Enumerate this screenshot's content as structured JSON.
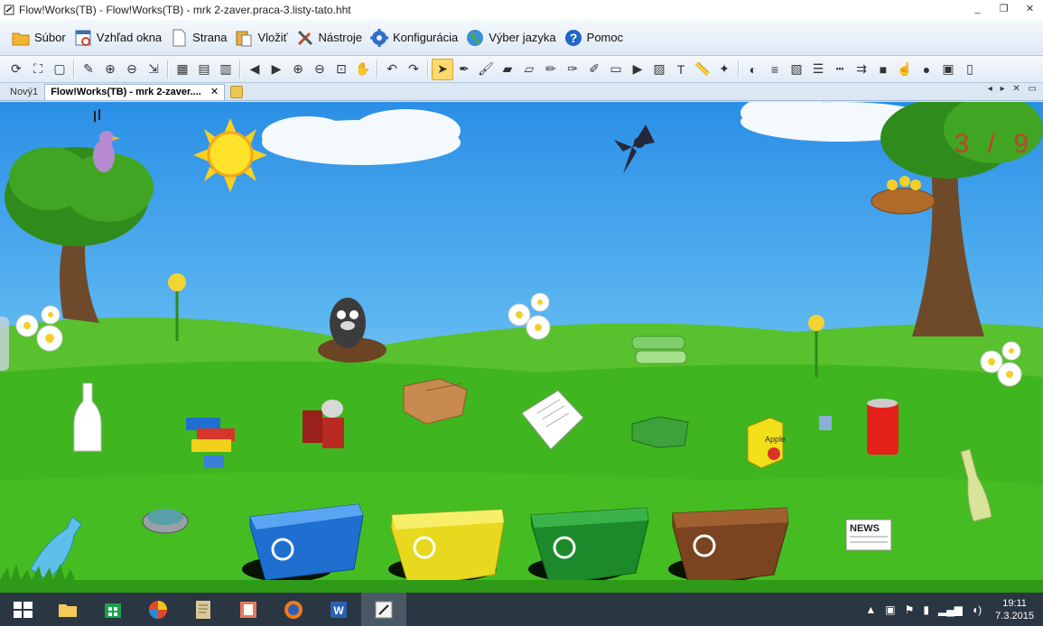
{
  "window": {
    "title": "Flow!Works(TB) - Flow!Works(TB) - mrk 2-zaver.praca-3.listy-tato.hht",
    "controls": [
      "_",
      "❐",
      "✕"
    ]
  },
  "menu": [
    {
      "label": "Súbor",
      "icon": "folder-icon"
    },
    {
      "label": "Vzhľad okna",
      "icon": "refresh-window-icon"
    },
    {
      "label": "Strana",
      "icon": "page-icon"
    },
    {
      "label": "Vložiť",
      "icon": "paste-icon"
    },
    {
      "label": "Nástroje",
      "icon": "tools-icon"
    },
    {
      "label": "Konfigurácia",
      "icon": "gear-icon"
    },
    {
      "label": "Výber jazyka",
      "icon": "globe-icon"
    },
    {
      "label": "Pomoc",
      "icon": "help-icon"
    }
  ],
  "toolbar": {
    "items": [
      "refresh",
      "fullscreen",
      "window",
      "|",
      "edit",
      "new-page",
      "delete-page",
      "import-page",
      "|",
      "image-page",
      "save-page",
      "page-settings",
      "|",
      "prev-page",
      "next-page",
      "zoom-in",
      "zoom-out",
      "zoom-fit",
      "pan-hand",
      "|",
      "undo",
      "redo",
      "|",
      "select-arrow",
      "pen",
      "brush",
      "marker",
      "highlighter",
      "pencil",
      "fountain-pen",
      "creative-pen",
      "eraser",
      "video",
      "image",
      "text",
      "ruler",
      "magic-wand",
      "|",
      "palette",
      "line-style",
      "hatch",
      "list",
      "dashes",
      "arrows",
      "camera",
      "hand-pointer",
      "colors",
      "screen",
      "phone"
    ],
    "active": "select-arrow"
  },
  "tabs": [
    {
      "label": "Nový1",
      "active": false
    },
    {
      "label": "Flow!Works(TB) - mrk 2-zaver....",
      "active": true
    }
  ],
  "tab_close": "✕",
  "tab_nav": "◂ ▸ ✕ ▭",
  "canvas": {
    "page_counter": "3 / 9",
    "items": [
      {
        "name": "sun"
      },
      {
        "name": "cloud"
      },
      {
        "name": "bird-swallow"
      },
      {
        "name": "bird-singing"
      },
      {
        "name": "mole"
      },
      {
        "name": "glass-bottle"
      },
      {
        "name": "lego-bricks"
      },
      {
        "name": "tin-cans"
      },
      {
        "name": "cardboard-box"
      },
      {
        "name": "paper-sheets"
      },
      {
        "name": "broken-bottle"
      },
      {
        "name": "plastic-bottles"
      },
      {
        "name": "juice-box",
        "label": "Apple"
      },
      {
        "name": "soda-can"
      },
      {
        "name": "wine-bottle"
      },
      {
        "name": "plastic-bottle-blue"
      },
      {
        "name": "tuna-can"
      },
      {
        "name": "newspaper",
        "label": "NEWS"
      },
      {
        "name": "bin-blue"
      },
      {
        "name": "bin-yellow"
      },
      {
        "name": "bin-green"
      },
      {
        "name": "bin-brown"
      },
      {
        "name": "bird-nest"
      }
    ]
  },
  "taskbar": {
    "apps": [
      "windows-start-icon",
      "file-explorer-icon",
      "store-icon",
      "picasa-icon",
      "notes-icon",
      "powerpoint-icon",
      "firefox-icon",
      "word-icon",
      "flowworks-icon"
    ],
    "active_app": "flowworks-icon",
    "time": "19:11",
    "date": "7.3.2015"
  },
  "colors": {
    "sky_top": "#2a8fe6",
    "grass": "#3fb51f",
    "bin_blue": "#1f6fd1",
    "bin_yellow": "#e8d91e",
    "bin_green": "#1c8a2a",
    "bin_brown": "#7a4420",
    "toolbar_active": "#ffd96b",
    "counter": "#c8402a"
  }
}
